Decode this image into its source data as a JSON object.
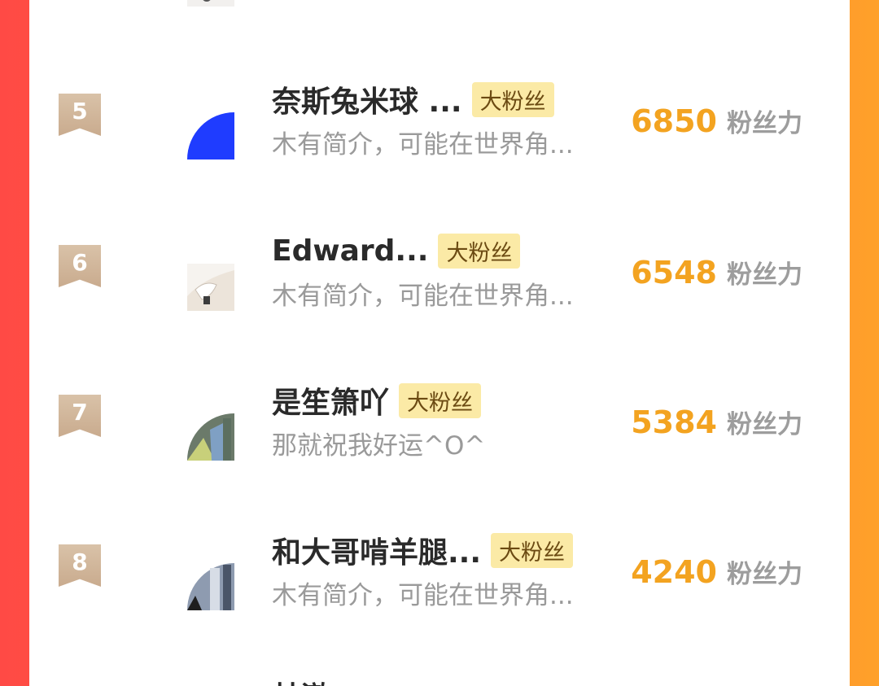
{
  "list": {
    "rows": [
      {
        "rank": "5",
        "name": "奈斯兔米球 ...",
        "badge": "大粉丝",
        "bio": "木有简介，可能在世界角...",
        "score": "6850",
        "score_unit": "粉丝力",
        "avatar": "blue-quarter-circle"
      },
      {
        "rank": "6",
        "name": "Edward...",
        "badge": "大粉丝",
        "bio": "木有简介，可能在世界角...",
        "score": "6548",
        "score_unit": "粉丝力",
        "avatar": "sketch-photo"
      },
      {
        "rank": "7",
        "name": "是笙箫吖",
        "badge": "大粉丝",
        "bio": "那就祝我好运^O^",
        "score": "5384",
        "score_unit": "粉丝力",
        "avatar": "street-photo"
      },
      {
        "rank": "8",
        "name": "和大哥啃羊腿...",
        "badge": "大粉丝",
        "bio": "木有简介，可能在世界角...",
        "score": "4240",
        "score_unit": "粉丝力",
        "avatar": "building-photo"
      }
    ],
    "partial_bottom_name": "林澈"
  },
  "colors": {
    "score": "#f3a320",
    "badge_bg": "#fbeaa6",
    "gradient_left": "#ff4a45",
    "gradient_right": "#ffa12a"
  }
}
